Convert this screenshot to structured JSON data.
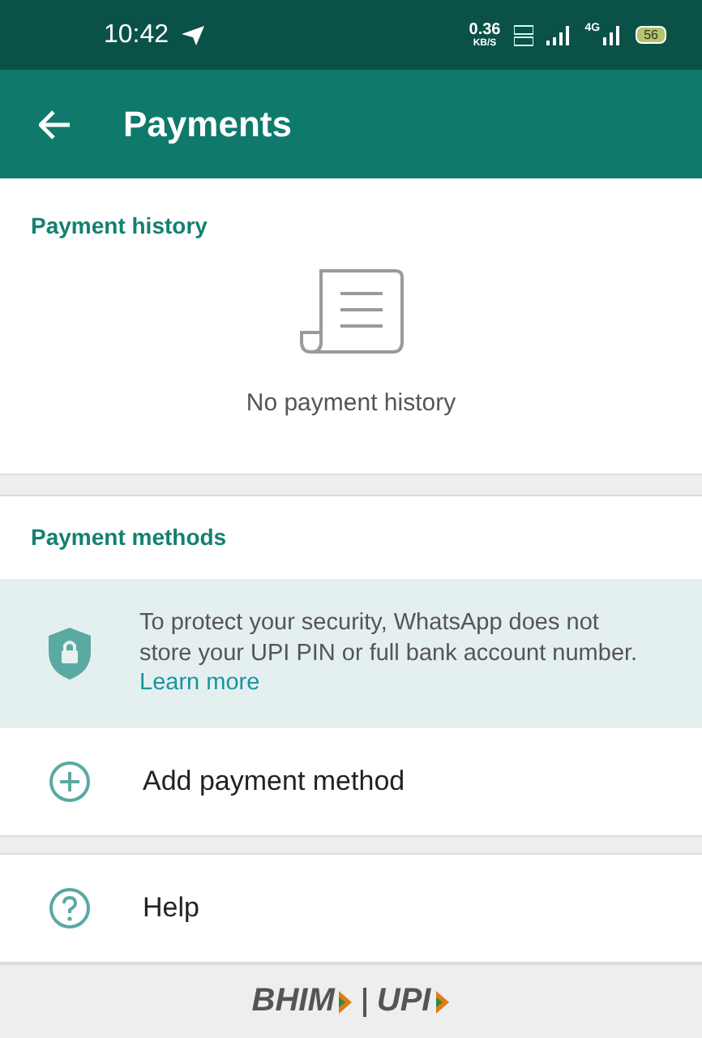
{
  "status_bar": {
    "time": "10:42",
    "speed": "0.36",
    "speed_unit": "KB/S",
    "network": "4G",
    "battery": "56"
  },
  "app_bar": {
    "title": "Payments"
  },
  "payment_history": {
    "heading": "Payment history",
    "empty_text": "No payment history"
  },
  "payment_methods": {
    "heading": "Payment methods",
    "notice": "To protect your security, WhatsApp does not store your UPI PIN or full bank account number.",
    "notice_link": "Learn more"
  },
  "actions": [
    {
      "kind": "add",
      "label": "Add payment method"
    },
    {
      "kind": "help",
      "label": "Help"
    }
  ],
  "footer": {
    "logo_left": "BHIM",
    "logo_right": "UPI"
  }
}
